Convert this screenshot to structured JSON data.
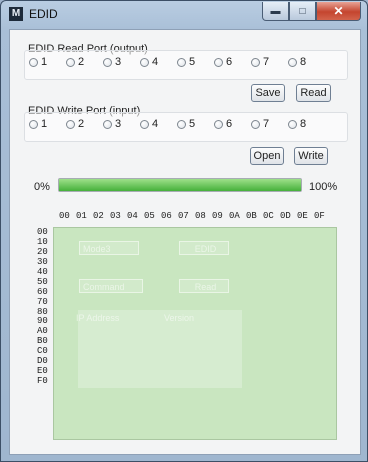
{
  "window": {
    "icon_text": "M",
    "title": "EDID"
  },
  "read_group": {
    "label": "EDID Read Port (output)",
    "ports": [
      "1",
      "2",
      "3",
      "4",
      "5",
      "6",
      "7",
      "8"
    ],
    "save_label": "Save",
    "read_label": "Read"
  },
  "write_group": {
    "label": "EDID Write Port (input)",
    "ports": [
      "1",
      "2",
      "3",
      "4",
      "5",
      "6",
      "7",
      "8"
    ],
    "open_label": "Open",
    "write_label": "Write"
  },
  "progress": {
    "left_label": "0%",
    "right_label": "100%",
    "value_percent": 100
  },
  "hex": {
    "columns": [
      "00",
      "01",
      "02",
      "03",
      "04",
      "05",
      "06",
      "07",
      "08",
      "09",
      "0A",
      "0B",
      "0C",
      "0D",
      "0E",
      "0F"
    ],
    "rows": [
      "00",
      "10",
      "20",
      "30",
      "40",
      "50",
      "60",
      "70",
      "80",
      "90",
      "A0",
      "B0",
      "C0",
      "D0",
      "E0",
      "F0"
    ]
  },
  "background_window": {
    "mode_label": "Mode3",
    "command_label": "Command",
    "edid_label": "EDID",
    "read_label": "Read",
    "col_ip": "IP Address",
    "col_version": "Version"
  },
  "colors": {
    "grid_bg": "#c9e6c0",
    "close_button": "#c4452f",
    "progress_fill": "#45b03a"
  }
}
